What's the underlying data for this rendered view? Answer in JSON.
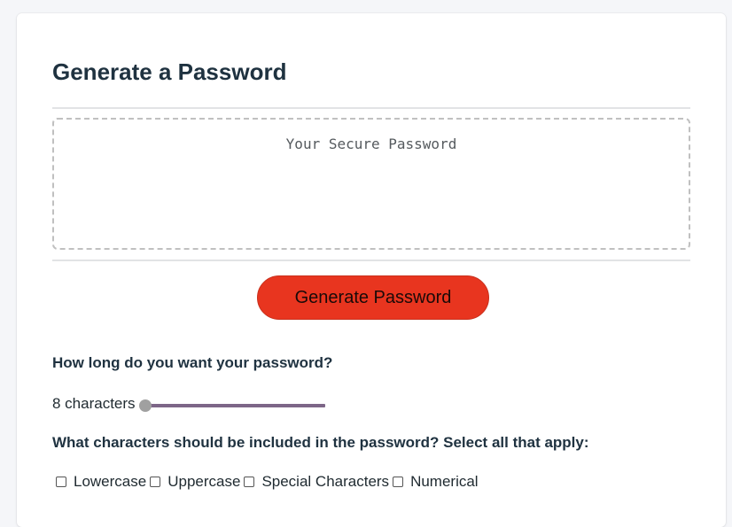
{
  "card": {
    "title": "Generate a Password"
  },
  "password_output": {
    "placeholder": "Your Secure Password",
    "value": ""
  },
  "generate_button": {
    "label": "Generate Password",
    "color": "#e8351f"
  },
  "length": {
    "question": "How long do you want your password?",
    "value_text": "8 characters",
    "slider_level_fraction": 0
  },
  "character_types": {
    "question": "What characters should be included in the password? Select all that apply:",
    "options": [
      {
        "label": "Lowercase",
        "checked": false
      },
      {
        "label": "Uppercase",
        "checked": false
      },
      {
        "label": "Special Characters",
        "checked": false
      },
      {
        "label": "Numerical",
        "checked": false
      }
    ]
  }
}
